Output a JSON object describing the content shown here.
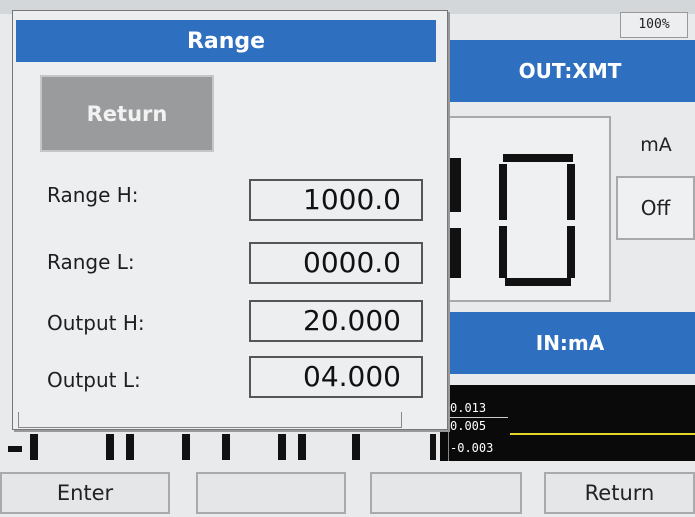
{
  "status": {
    "battery": "100%"
  },
  "right_panel": {
    "out_header": "OUT:XMT",
    "unit": "mA",
    "output_state": "Off",
    "in_header": "IN:mA",
    "graph_ticks": [
      "0.013",
      "0.005",
      "-0.003"
    ]
  },
  "dialog": {
    "title": "Range",
    "return_label": "Return",
    "rows": [
      {
        "label": "Range H:",
        "value": "1000.0"
      },
      {
        "label": "Range L:",
        "value": "0000.0"
      },
      {
        "label": "Output H:",
        "value": "20.000"
      },
      {
        "label": "Output L:",
        "value": "04.000"
      }
    ]
  },
  "softkeys": [
    "Enter",
    "",
    "",
    "Return"
  ],
  "colors": {
    "accent": "#2f6fc0",
    "trace": "#e3d72a"
  }
}
